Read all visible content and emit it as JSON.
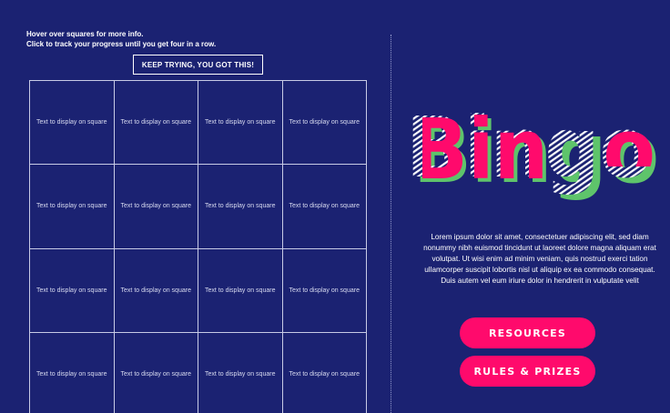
{
  "instructions": {
    "line1": "Hover over squares for more info.",
    "line2": "Click to track your progress until you get four in a row."
  },
  "status_message": "KEEP TRYING, YOU GOT THIS!",
  "grid": {
    "cells": [
      "Text to display on square",
      "Text to display on square",
      "Text to display on square",
      "Text to display on square",
      "Text to display on square",
      "Text to display on square",
      "Text to display on square",
      "Text to display on square",
      "Text to display on square",
      "Text to display on square",
      "Text to display on square",
      "Text to display on square",
      "Text to display on square",
      "Text to display on square",
      "Text to display on square",
      "Text to display on square"
    ]
  },
  "logo": {
    "text": "Bingo"
  },
  "description": "Lorem ipsum dolor sit amet, consectetuer adipiscing elit, sed diam nonummy nibh euismod tincidunt ut laoreet dolore magna aliquam erat volutpat. Ut wisi enim ad minim veniam, quis nostrud exerci tation ullamcorper suscipit lobortis nisl ut aliquip ex ea commodo consequat. Duis autem vel eum iriure dolor in hendrerit in vulputate velit",
  "buttons": {
    "resources": "RESOURCES",
    "rules": "RULES & PRIZES"
  },
  "colors": {
    "background": "#1b2272",
    "accent_pink": "#ff0a6c",
    "accent_green": "#5ec46b",
    "grid_line": "#c8cbe6"
  }
}
